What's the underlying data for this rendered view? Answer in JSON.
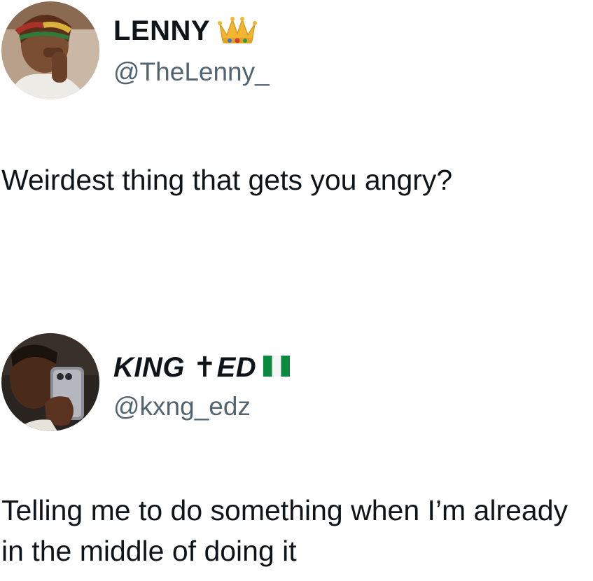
{
  "tweets": [
    {
      "display_name": "LENNY",
      "name_emoji": "crown-icon",
      "handle": "@TheLenny_",
      "text": "Weirdest thing that gets you angry?"
    },
    {
      "display_name": "KING ✝ED",
      "name_emoji": "nigeria-flag-icon",
      "handle": "@kxng_edz",
      "text": "Telling me to do something when I’m already in the middle of doing it"
    }
  ],
  "colors": {
    "text": "#0f1419",
    "handle": "#536471",
    "background": "#ffffff",
    "crown_gold": "#f2b632",
    "flag_green": "#0b8a3e"
  }
}
